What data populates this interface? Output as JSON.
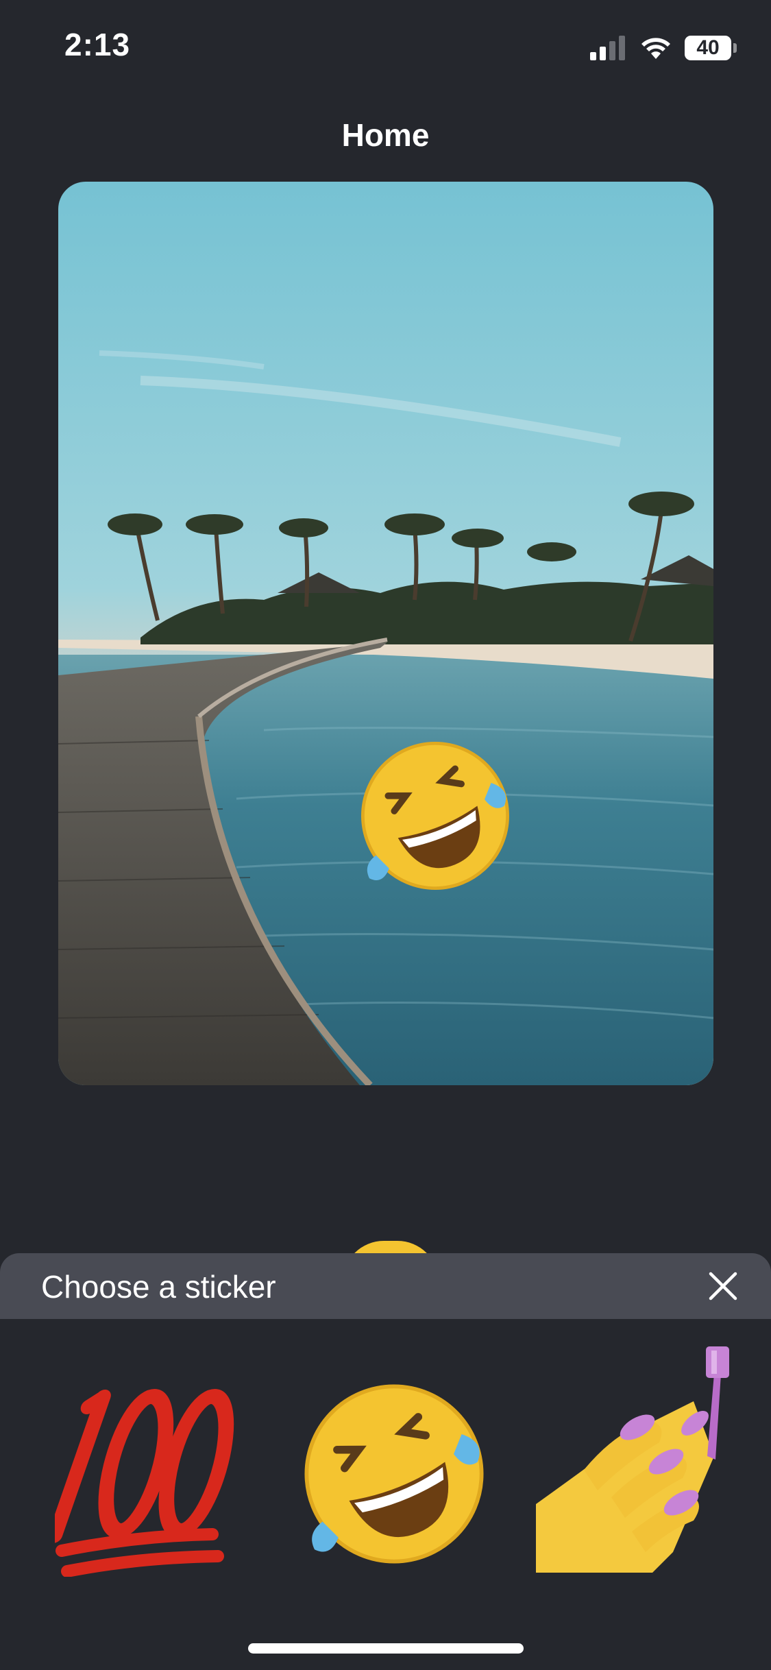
{
  "status_bar": {
    "time": "2:13",
    "battery": "40",
    "icons": [
      "signal-icon",
      "wifi-icon",
      "battery-icon"
    ]
  },
  "nav": {
    "title": "Home"
  },
  "photo": {
    "placed_sticker": "rolling-on-floor-laughing-emoji"
  },
  "sticker_panel": {
    "title": "Choose a sticker",
    "close_icon": "close-icon",
    "stickers": [
      {
        "name": "hundred-points-emoji"
      },
      {
        "name": "rolling-on-floor-laughing-emoji"
      },
      {
        "name": "nail-polish-emoji"
      }
    ]
  },
  "colors": {
    "background": "#25272d",
    "panel_header": "#494b54",
    "text": "#ffffff"
  }
}
